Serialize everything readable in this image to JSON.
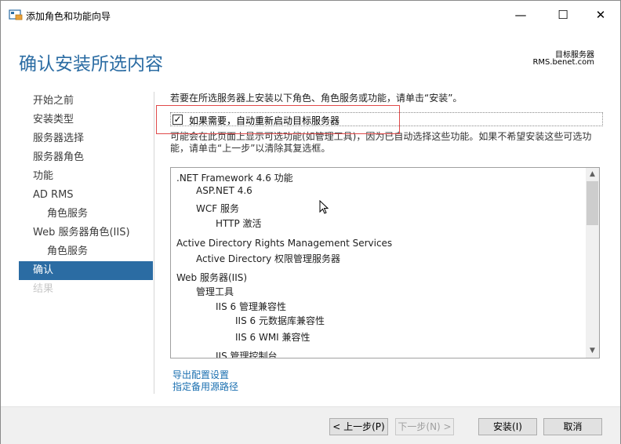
{
  "window": {
    "title": "添加角色和功能向导",
    "minimize_glyph": "—",
    "maximize_glyph": "☐",
    "close_glyph": "✕"
  },
  "header": {
    "page_title": "确认安装所选内容",
    "dest_label": "目标服务器",
    "dest_server": "RMS.benet.com"
  },
  "sidebar": {
    "items": [
      {
        "label": "开始之前",
        "state": "normal",
        "level": 0
      },
      {
        "label": "安装类型",
        "state": "normal",
        "level": 0
      },
      {
        "label": "服务器选择",
        "state": "normal",
        "level": 0
      },
      {
        "label": "服务器角色",
        "state": "normal",
        "level": 0
      },
      {
        "label": "功能",
        "state": "normal",
        "level": 0
      },
      {
        "label": "AD RMS",
        "state": "normal",
        "level": 0
      },
      {
        "label": "角色服务",
        "state": "normal",
        "level": 1
      },
      {
        "label": "Web 服务器角色(IIS)",
        "state": "normal",
        "level": 0
      },
      {
        "label": "角色服务",
        "state": "normal",
        "level": 1
      },
      {
        "label": "确认",
        "state": "active",
        "level": 0
      },
      {
        "label": "结果",
        "state": "disabled",
        "level": 0
      }
    ]
  },
  "content": {
    "instruction": "若要在所选服务器上安装以下角色、角色服务或功能，请单击“安装”。",
    "restart_checkbox": {
      "checked": true,
      "check_glyph": "✓",
      "label": "如果需要，自动重新启动目标服务器"
    },
    "note": "可能会在此页面上显示可选功能(如管理工具)，因为已自动选择这些功能。如果不希望安装这些可选功能，请单击“上一步”以清除其复选框。",
    "features": [
      {
        "label": ".NET Framework 4.6 功能",
        "indent": 0
      },
      {
        "label": "ASP.NET 4.6",
        "indent": 1
      },
      {
        "label": "WCF 服务",
        "indent": 1
      },
      {
        "label": "HTTP 激活",
        "indent": 2
      },
      {
        "label": "Active Directory Rights Management Services",
        "indent": 0
      },
      {
        "label": "Active Directory 权限管理服务器",
        "indent": 1
      },
      {
        "label": "Web 服务器(IIS)",
        "indent": 0
      },
      {
        "label": "管理工具",
        "indent": 1
      },
      {
        "label": "IIS 6 管理兼容性",
        "indent": 2
      },
      {
        "label": "IIS 6 元数据库兼容性",
        "indent": 3
      },
      {
        "label": "IIS 6 WMI 兼容性",
        "indent": 3
      },
      {
        "label": "IIS 管理控制台",
        "indent": 2
      }
    ],
    "scroll_up_glyph": "▲",
    "scroll_down_glyph": "▼",
    "links": {
      "export": "导出配置设置",
      "alt_source": "指定备用源路径"
    }
  },
  "footer": {
    "prev": "< 上一步(P)",
    "next": "下一步(N) >",
    "install": "安装(I)",
    "cancel": "取消"
  },
  "colors": {
    "accent": "#2b6ca3",
    "link": "#1a6fb0",
    "highlight": "#e04a4a"
  }
}
